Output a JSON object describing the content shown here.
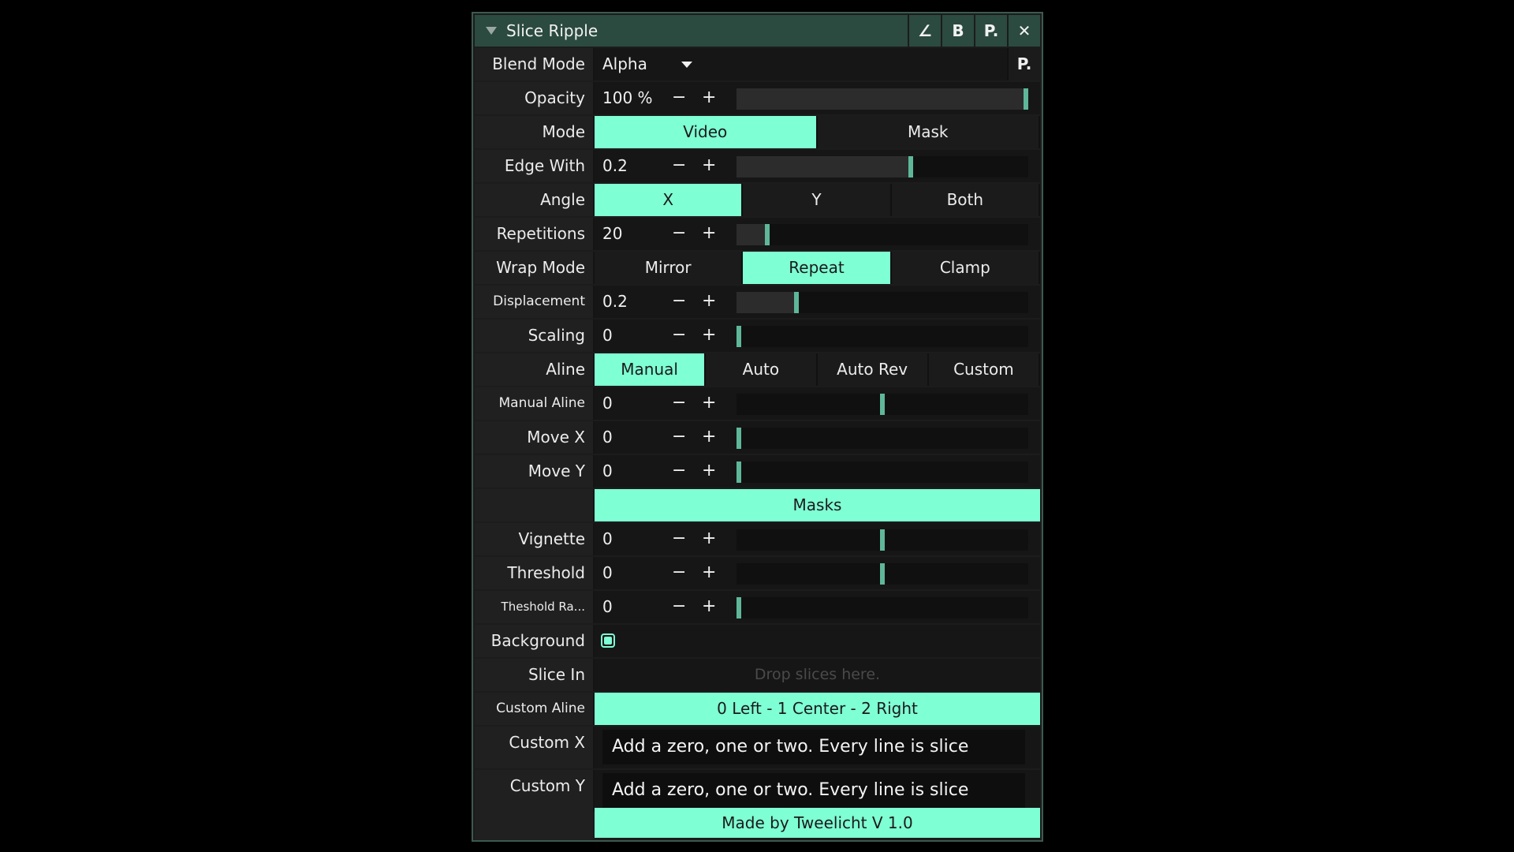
{
  "panel": {
    "title": "Slice Ripple",
    "header_buttons": [
      "∠",
      "B",
      "P.",
      "✕"
    ],
    "blend_mode": {
      "label": "Blend Mode",
      "value": "Alpha",
      "p_button": "P."
    },
    "opacity": {
      "label": "Opacity",
      "value": "100 %",
      "level": 1.0
    },
    "mode": {
      "label": "Mode",
      "options": [
        "Video",
        "Mask"
      ],
      "selected": "Video"
    },
    "edge_with": {
      "label": "Edge With",
      "value": "0.2",
      "level": 0.6
    },
    "angle": {
      "label": "Angle",
      "options": [
        "X",
        "Y",
        "Both"
      ],
      "selected": "X"
    },
    "repetitions": {
      "label": "Repetitions",
      "value": "20",
      "level": 0.1
    },
    "wrap_mode": {
      "label": "Wrap Mode",
      "options": [
        "Mirror",
        "Repeat",
        "Clamp"
      ],
      "selected": "Repeat"
    },
    "displacement": {
      "label": "Displacement",
      "value": "0.2",
      "level": 0.2
    },
    "scaling": {
      "label": "Scaling",
      "value": "0",
      "level": 0.0
    },
    "aline": {
      "label": "Aline",
      "options": [
        "Manual",
        "Auto",
        "Auto Rev",
        "Custom"
      ],
      "selected": "Manual"
    },
    "manual_aline": {
      "label": "Manual Aline",
      "value": "0",
      "level": 0.5
    },
    "move_x": {
      "label": "Move X",
      "value": "0",
      "level": 0.0
    },
    "move_y": {
      "label": "Move Y",
      "value": "0",
      "level": 0.0
    },
    "masks_header": "Masks",
    "vignette": {
      "label": "Vignette",
      "value": "0",
      "level": 0.5
    },
    "threshold": {
      "label": "Threshold",
      "value": "0",
      "level": 0.5
    },
    "threshold_range": {
      "label": "Theshold Ra...",
      "value": "0",
      "level": 0.0
    },
    "background": {
      "label": "Background",
      "checked": true
    },
    "slice_in": {
      "label": "Slice In",
      "placeholder": "Drop slices here."
    },
    "custom_aline": {
      "label": "Custom Aline",
      "hint": "0 Left - 1 Center - 2 Right"
    },
    "custom_x": {
      "label": "Custom X",
      "value": "Add a zero, one or two. Every line is slice"
    },
    "custom_y": {
      "label": "Custom Y",
      "value": "Add a zero, one or two. Every line is slice"
    },
    "footer": "Made by Tweelicht V 1.0",
    "accent_color": "#7fffd4"
  }
}
